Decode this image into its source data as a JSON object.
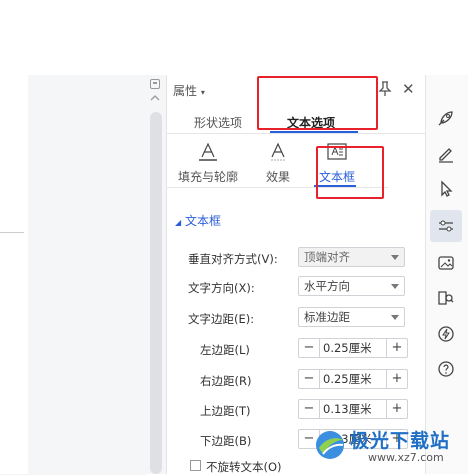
{
  "panel": {
    "title": "属性",
    "tabs": [
      {
        "label": "形状选项",
        "active": false
      },
      {
        "label": "文本选项",
        "active": true
      }
    ],
    "subtabs": [
      {
        "label": "填充与轮廓",
        "icon": "text-fill-outline-icon"
      },
      {
        "label": "效果",
        "icon": "text-effect-icon"
      },
      {
        "label": "文本框",
        "icon": "textbox-icon",
        "active": true
      }
    ],
    "section_title": "文本框",
    "fields": {
      "vertical_align": {
        "label": "垂直对齐方式(V):",
        "value": "顶端对齐",
        "disabled": true
      },
      "text_direction": {
        "label": "文字方向(X):",
        "value": "水平方向"
      },
      "text_margin": {
        "label": "文字边距(E):",
        "value": "标准边距"
      },
      "left_margin": {
        "label": "左边距(L)",
        "value": "0.25厘米"
      },
      "right_margin": {
        "label": "右边距(R)",
        "value": "0.25厘米"
      },
      "top_margin": {
        "label": "上边距(T)",
        "value": "0.13厘米"
      },
      "bottom_margin": {
        "label": "下边距(B)",
        "value": "0.13厘米"
      }
    },
    "no_rotate": {
      "label": "不旋转文本(O)",
      "checked": false
    }
  },
  "toolbar": {
    "icons": [
      "rocket-icon",
      "pen-icon",
      "cursor-icon",
      "sliders-icon",
      "image-icon",
      "book-search-icon",
      "lightning-icon",
      "help-icon"
    ],
    "active": "sliders-icon"
  },
  "watermark": {
    "name": "极光下载站",
    "url": "www.xz7.com"
  },
  "colors": {
    "accent": "#2b5fd9",
    "highlight": "#e8212b"
  }
}
